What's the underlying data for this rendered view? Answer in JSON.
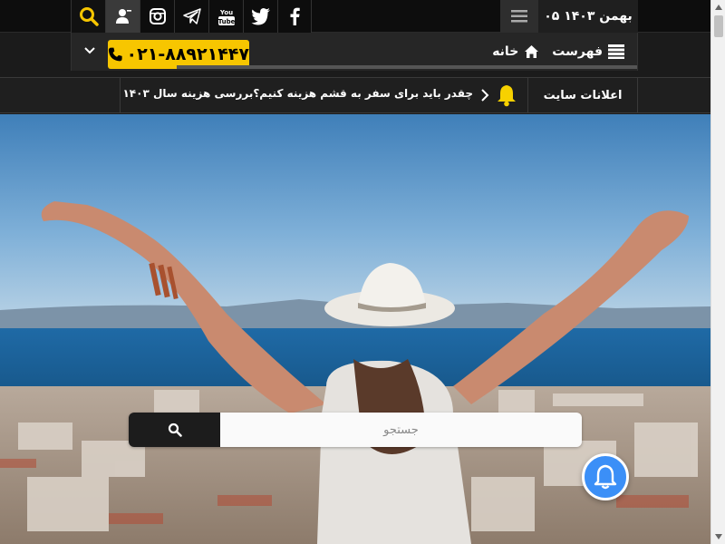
{
  "topbar": {
    "date": "۰۵ بهمن ۱۴۰۳",
    "social": [
      "search-icon",
      "user-icon",
      "instagram-icon",
      "telegram-icon",
      "youtube-icon",
      "twitter-icon",
      "facebook-icon"
    ],
    "youtube_label": "You Tube"
  },
  "nav": {
    "phone": "۰۲۱-۸۸۹۲۱۴۴۷",
    "home_label": "خانه",
    "menu_label": "فهرست"
  },
  "announcements": {
    "title": "اعلانات سایت",
    "text": "چقدر باید برای سفر به قشم هزینه کنیم؟بررسی هزینه سال ۱۴۰۳"
  },
  "search": {
    "placeholder": "جستجو"
  },
  "colors": {
    "accent": "#f7c600",
    "notify": "#3b8ff7",
    "dark": "#1b1b1b"
  }
}
